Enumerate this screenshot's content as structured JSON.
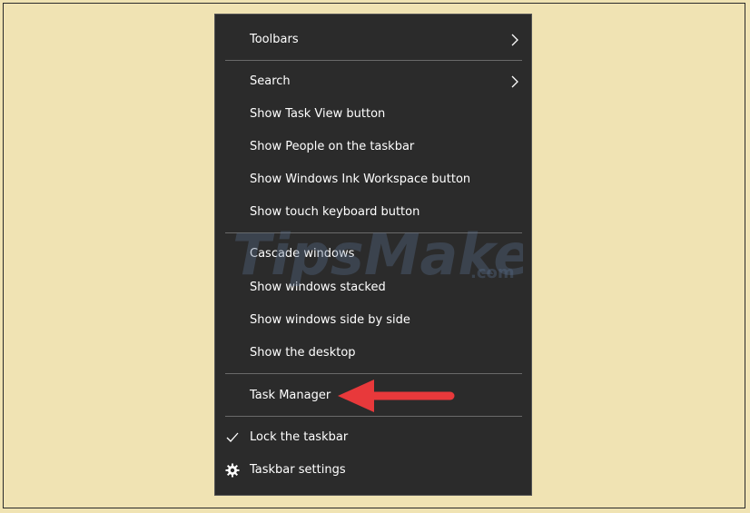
{
  "menu": {
    "items": [
      {
        "label": "Toolbars"
      },
      {
        "label": "Search"
      },
      {
        "label": "Show Task View button"
      },
      {
        "label": "Show People on the taskbar"
      },
      {
        "label": "Show Windows Ink Workspace button"
      },
      {
        "label": "Show touch keyboard button"
      },
      {
        "label": "Cascade windows"
      },
      {
        "label": "Show windows stacked"
      },
      {
        "label": "Show windows side by side"
      },
      {
        "label": "Show the desktop"
      },
      {
        "label": "Task Manager"
      },
      {
        "label": "Lock the taskbar"
      },
      {
        "label": "Taskbar settings"
      }
    ],
    "submenu_icon": "chevron-right-icon",
    "lock_state_icon": "checkmark-icon",
    "settings_icon": "gear-icon"
  },
  "annotation": {
    "arrow_color": "#e8393b",
    "arrow_icon": "arrow-left-icon"
  },
  "watermark": {
    "text_main": "TipsMake",
    "text_suffix": ".com"
  },
  "colors": {
    "menu_bg": "#2b2b2b",
    "page_bg": "#f0e3b3",
    "text": "#ffffff"
  }
}
